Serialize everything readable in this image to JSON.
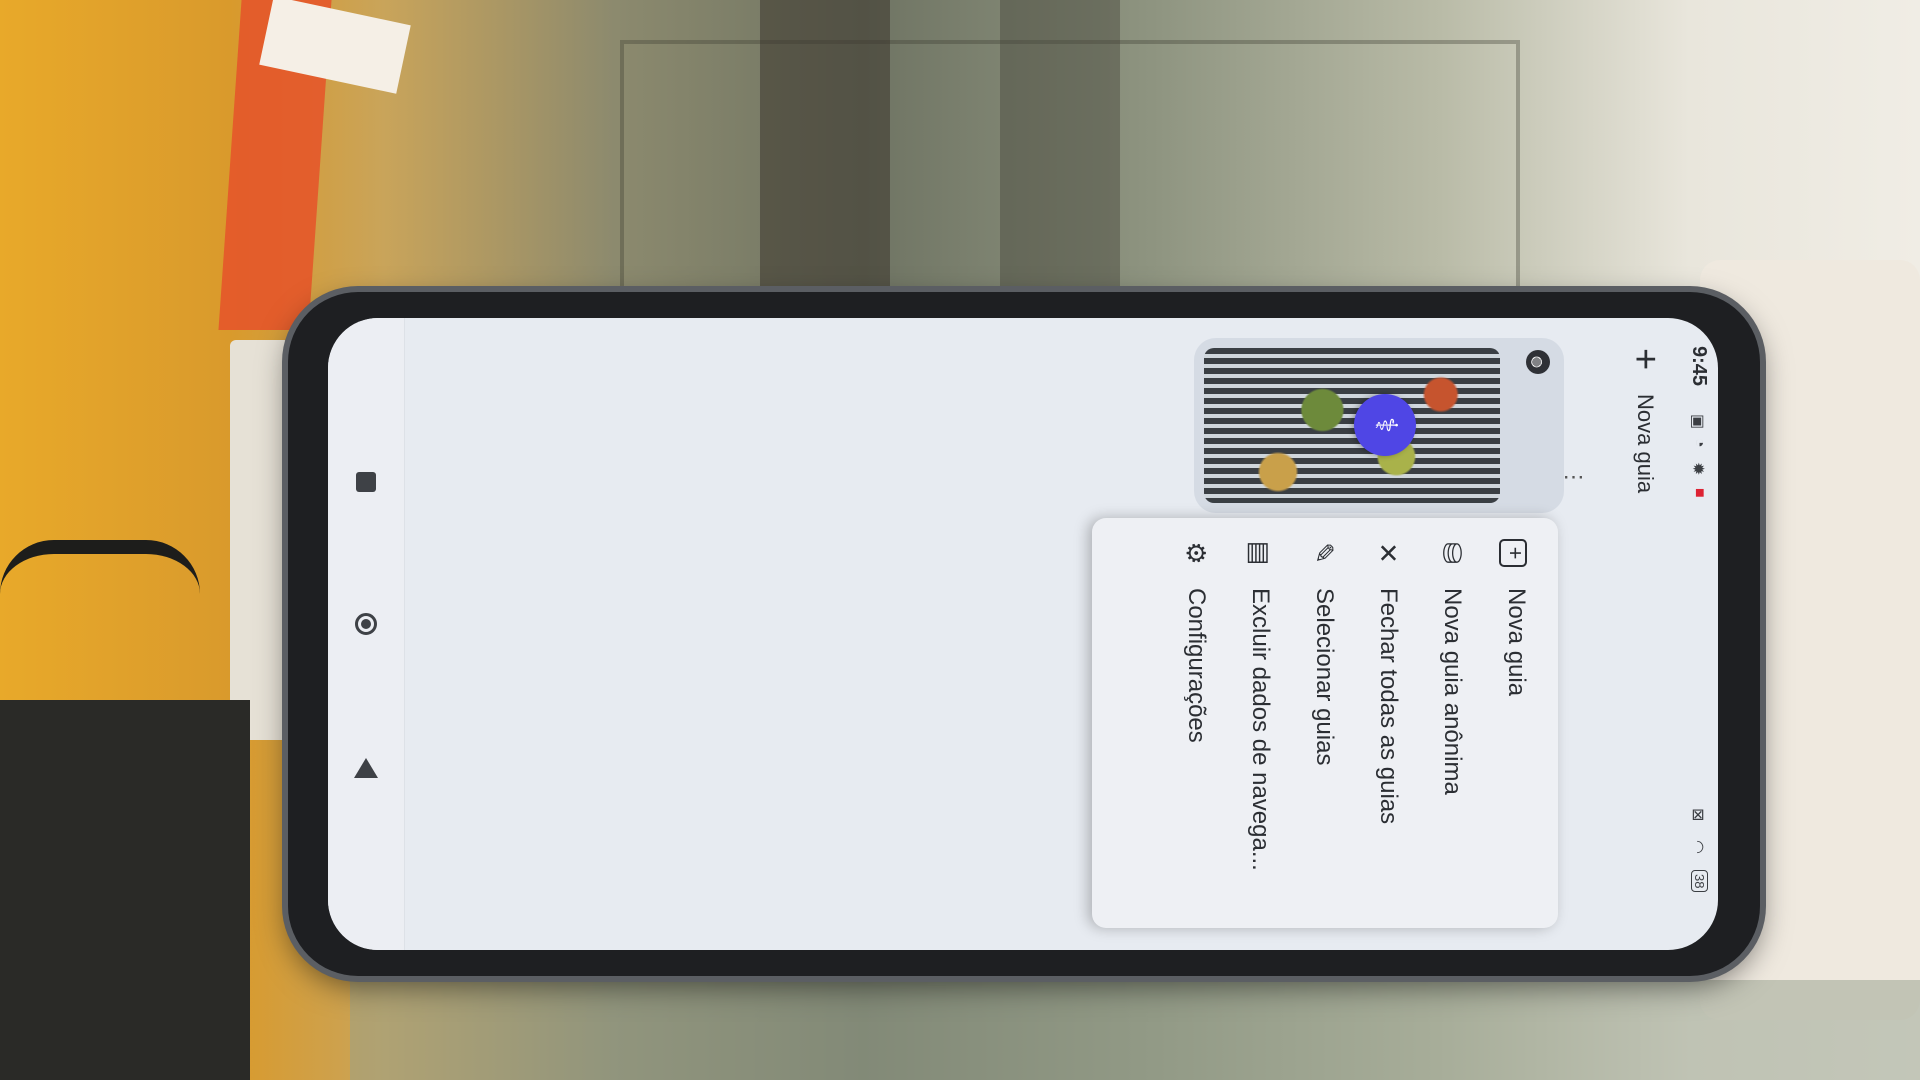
{
  "status_bar": {
    "time": "9:45",
    "battery": "38"
  },
  "toolbar": {
    "new_tab_label": "Nova guia"
  },
  "tab": {
    "favicon": "globe-icon",
    "badge_icon": "stethoscope-icon"
  },
  "menu": {
    "items": [
      {
        "label": "Nova guia",
        "icon": "new-tab-icon"
      },
      {
        "label": "Nova guia anônima",
        "icon": "incognito-icon"
      },
      {
        "label": "Fechar todas as guias",
        "icon": "close-icon"
      },
      {
        "label": "Selecionar guias",
        "icon": "pencil-icon"
      },
      {
        "label": "Excluir dados de navega...",
        "icon": "delete-data-icon"
      },
      {
        "label": "Configurações",
        "icon": "gear-icon"
      }
    ]
  }
}
